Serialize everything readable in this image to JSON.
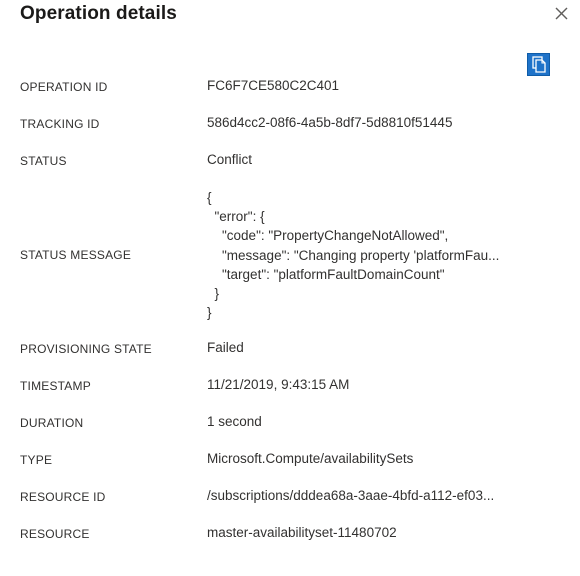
{
  "panel": {
    "title": "Operation details",
    "close_label": "Close",
    "copy_label": "Copy"
  },
  "fields": {
    "operation_id": {
      "label": "OPERATION ID",
      "value": "FC6F7CE580C2C401"
    },
    "tracking_id": {
      "label": "TRACKING ID",
      "value": "586d4cc2-08f6-4a5b-8df7-5d8810f51445"
    },
    "status": {
      "label": "STATUS",
      "value": "Conflict"
    },
    "status_message": {
      "label": "STATUS MESSAGE",
      "lines": [
        "{",
        "  \"error\": {",
        "    \"code\": \"PropertyChangeNotAllowed\",",
        "    \"message\": \"Changing property 'platformFau...",
        "    \"target\": \"platformFaultDomainCount\"",
        "  }",
        "}"
      ]
    },
    "provisioning_state": {
      "label": "PROVISIONING STATE",
      "value": "Failed"
    },
    "timestamp": {
      "label": "TIMESTAMP",
      "value": "11/21/2019, 9:43:15 AM"
    },
    "duration": {
      "label": "DURATION",
      "value": "1 second"
    },
    "type": {
      "label": "TYPE",
      "value": "Microsoft.Compute/availabilitySets"
    },
    "resource_id": {
      "label": "RESOURCE ID",
      "value": "/subscriptions/dddea68a-3aae-4bfd-a112-ef03..."
    },
    "resource": {
      "label": "RESOURCE",
      "value": "master-availabilityset-11480702"
    }
  },
  "icons": {
    "close": "close-icon",
    "copy": "copy-icon"
  },
  "colors": {
    "accent": "#1f73c9",
    "text": "#323130"
  }
}
